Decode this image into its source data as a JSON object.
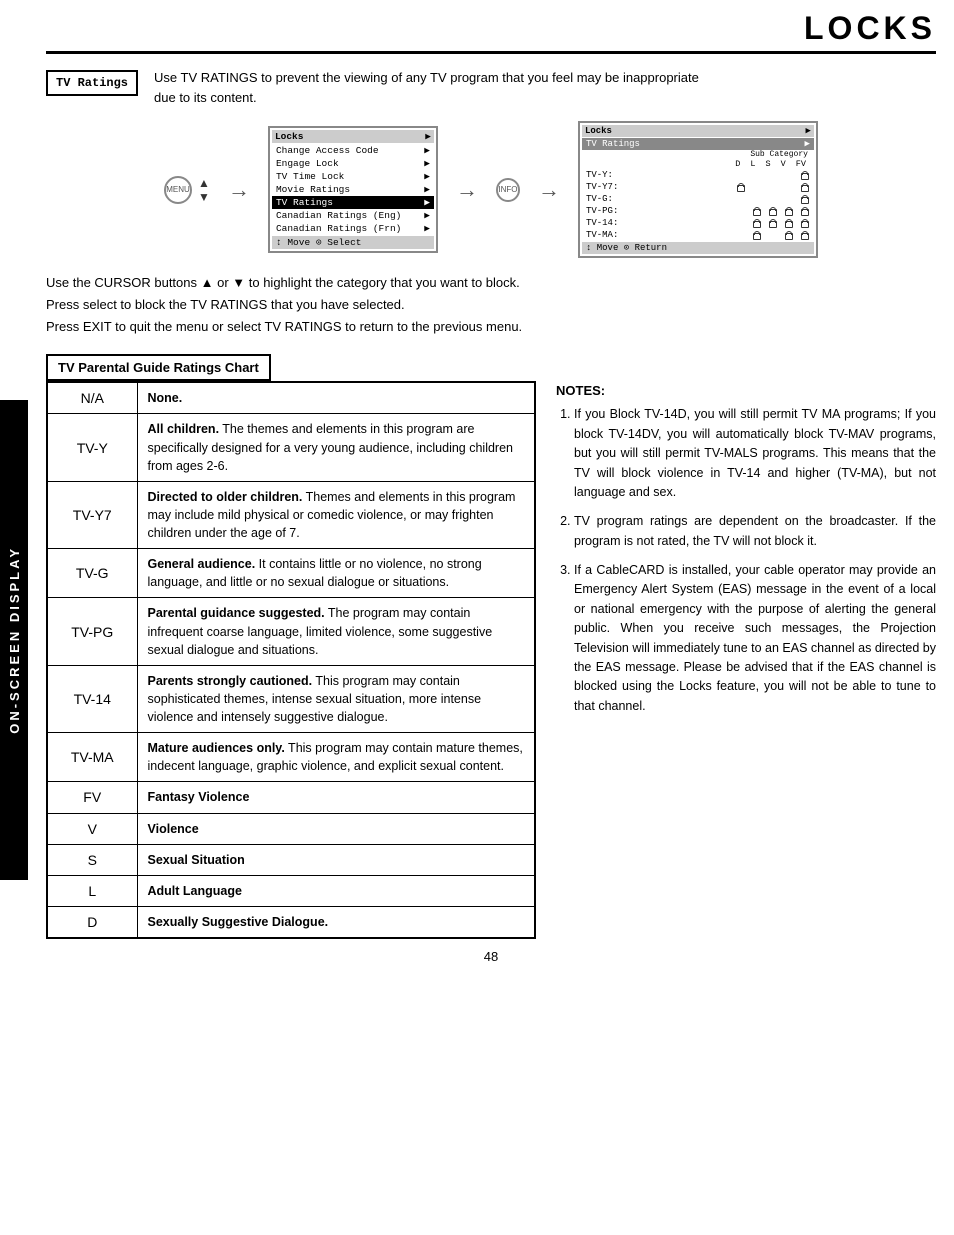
{
  "page": {
    "title": "LOCKS",
    "page_number": "48"
  },
  "sidebar": {
    "label": "ON-SCREEN DISPLAY"
  },
  "tv_ratings": {
    "box_label": "TV Ratings",
    "description_line1": "Use TV RATINGS to prevent the viewing of any TV program that you feel may be inappropriate",
    "description_line2": "due to its content."
  },
  "menu_screen": {
    "title": "Locks",
    "items": [
      "Change Access Code",
      "Engage Lock",
      "TV Time Lock",
      "Movie Ratings",
      "TV Ratings",
      "Canadian Ratings (Eng)",
      "Canadian Ratings (Frn)"
    ],
    "selected_item": "TV Ratings",
    "footer": "↕ Move ⊙ Select"
  },
  "tv_ratings_screen": {
    "title": "Locks",
    "subtitle": "TV Ratings",
    "subcat_label": "Sub Category",
    "col_headers": [
      "D",
      "L",
      "S",
      "V",
      "FV"
    ],
    "rows": [
      {
        "label": "TV-Y:",
        "locks": [
          true,
          false,
          false,
          false,
          false
        ],
        "extra": false
      },
      {
        "label": "TV-Y7:",
        "locks": [
          true,
          false,
          false,
          false,
          false
        ],
        "extra": true
      },
      {
        "label": "TV-G:",
        "locks": [
          true,
          false,
          false,
          false,
          false
        ],
        "extra": false
      },
      {
        "label": "TV-PG:",
        "locks": [
          true,
          true,
          true,
          true,
          true
        ],
        "extra": false
      },
      {
        "label": "TV-14:",
        "locks": [
          true,
          true,
          true,
          true,
          true
        ],
        "extra": false
      },
      {
        "label": "TV-MA:",
        "locks": [
          true,
          false,
          true,
          true,
          false
        ],
        "extra": false
      }
    ],
    "footer": "↕ Move ⊙ Return"
  },
  "info_text": {
    "line1": "Use the CURSOR buttons ▲ or ▼ to highlight the category that you want to block.",
    "line2": "Press select to block the TV RATINGS that you have selected.",
    "line3": "Press EXIT to quit the menu or select TV RATINGS to return to the previous menu."
  },
  "chart_header": "TV Parental Guide Ratings Chart",
  "ratings": [
    {
      "code": "N/A",
      "bold_text": "None.",
      "regular_text": ""
    },
    {
      "code": "TV-Y",
      "bold_text": "All children.",
      "regular_text": " The themes and elements in this program are specifically designed for a very young audience, including children from ages 2-6."
    },
    {
      "code": "TV-Y7",
      "bold_text": "Directed to older children.",
      "regular_text": " Themes and elements in this program may include mild physical or comedic violence, or may frighten children under the age of 7."
    },
    {
      "code": "TV-G",
      "bold_text": "General audience.",
      "regular_text": " It contains little or no violence, no strong language, and little or no sexual dialogue or situations."
    },
    {
      "code": "TV-PG",
      "bold_text": "Parental guidance suggested.",
      "regular_text": " The program may contain infrequent coarse language, limited violence, some suggestive sexual dialogue and situations."
    },
    {
      "code": "TV-14",
      "bold_text": "Parents strongly cautioned.",
      "regular_text": " This program may contain sophisticated themes, intense sexual situation, more intense violence and intensely suggestive dialogue."
    },
    {
      "code": "TV-MA",
      "bold_text": "Mature audiences only.",
      "regular_text": " This program may contain mature themes, indecent language, graphic violence, and explicit sexual content."
    },
    {
      "code": "FV",
      "bold_text": "Fantasy Violence",
      "regular_text": ""
    },
    {
      "code": "V",
      "bold_text": "Violence",
      "regular_text": ""
    },
    {
      "code": "S",
      "bold_text": "Sexual Situation",
      "regular_text": ""
    },
    {
      "code": "L",
      "bold_text": "Adult Language",
      "regular_text": ""
    },
    {
      "code": "D",
      "bold_text": "Sexually Suggestive Dialogue.",
      "regular_text": ""
    }
  ],
  "notes": {
    "title": "NOTES:",
    "items": [
      "If you Block TV-14D, you will still permit TV MA programs; If you block TV-14DV, you will automatically block TV-MAV programs, but you will still permit TV-MALS programs. This means that the TV will block violence in TV-14 and higher (TV-MA), but not language and sex.",
      "TV program ratings are dependent on the broadcaster. If the program is not rated, the TV will not block it.",
      "If a CableCARD is installed, your cable operator may provide an Emergency Alert System (EAS) message in the event of a local or national emergency with the purpose of alerting the general public. When you receive such messages, the Projection Television will immediately tune to an EAS channel as directed by the EAS message. Please be advised that if the EAS channel is blocked using the Locks feature, you will not be able to tune to that channel."
    ]
  }
}
